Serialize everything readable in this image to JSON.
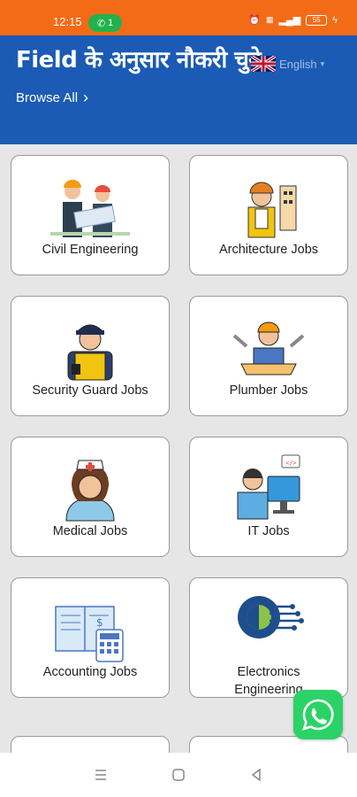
{
  "status": {
    "time": "12:15",
    "call_count": "1",
    "battery": "55"
  },
  "header": {
    "title": "Field के अनुसार नौकरी चुने",
    "browse_all": "Browse All",
    "language": "English"
  },
  "categories": [
    {
      "label": "Civil Engineering",
      "icon": "engineers-icon"
    },
    {
      "label": "Architecture Jobs",
      "icon": "architect-icon"
    },
    {
      "label": "Security Guard Jobs",
      "icon": "security-guard-icon"
    },
    {
      "label": "Plumber Jobs",
      "icon": "plumber-icon"
    },
    {
      "label": "Medical Jobs",
      "icon": "nurse-icon"
    },
    {
      "label": "IT Jobs",
      "icon": "it-worker-icon"
    },
    {
      "label": "Accounting Jobs",
      "icon": "accounting-icon"
    },
    {
      "label": "Electronics Engineering",
      "icon": "circuit-gear-icon"
    }
  ],
  "colors": {
    "status_bar": "#f36b16",
    "header": "#1b5bb5",
    "whatsapp": "#2bd366"
  }
}
